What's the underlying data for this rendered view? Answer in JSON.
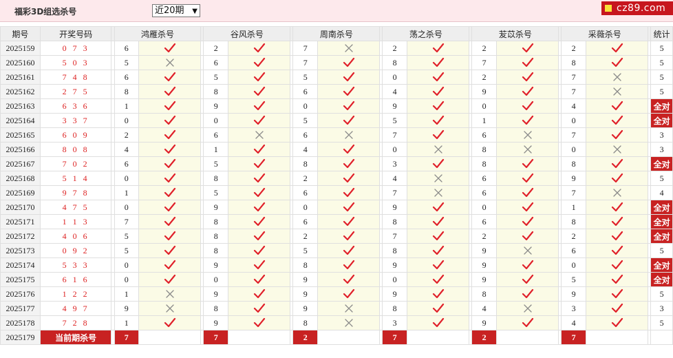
{
  "header": {
    "title": "福彩3D组选杀号",
    "period_select": "近20期",
    "logo": "cz89.com"
  },
  "columns": {
    "issue": "期号",
    "draw": "开奖号码",
    "experts": [
      "鸿雁杀号",
      "谷风杀号",
      "周南杀号",
      "荡之杀号",
      "苃苡杀号",
      "采薇杀号"
    ],
    "count": "统计"
  },
  "full_correct_label": "全对",
  "rows": [
    {
      "issue": "2025159",
      "draw": "0 7 3",
      "kills": [
        {
          "n": "6",
          "ok": true
        },
        {
          "n": "2",
          "ok": true
        },
        {
          "n": "7",
          "ok": false
        },
        {
          "n": "2",
          "ok": true
        },
        {
          "n": "2",
          "ok": true
        },
        {
          "n": "2",
          "ok": true
        }
      ],
      "count": "5"
    },
    {
      "issue": "2025160",
      "draw": "5 0 3",
      "kills": [
        {
          "n": "5",
          "ok": false
        },
        {
          "n": "6",
          "ok": true
        },
        {
          "n": "7",
          "ok": true
        },
        {
          "n": "8",
          "ok": true
        },
        {
          "n": "7",
          "ok": true
        },
        {
          "n": "8",
          "ok": true
        }
      ],
      "count": "5"
    },
    {
      "issue": "2025161",
      "draw": "7 4 8",
      "kills": [
        {
          "n": "6",
          "ok": true
        },
        {
          "n": "5",
          "ok": true
        },
        {
          "n": "5",
          "ok": true
        },
        {
          "n": "0",
          "ok": true
        },
        {
          "n": "2",
          "ok": true
        },
        {
          "n": "7",
          "ok": false
        }
      ],
      "count": "5"
    },
    {
      "issue": "2025162",
      "draw": "2 7 5",
      "kills": [
        {
          "n": "8",
          "ok": true
        },
        {
          "n": "8",
          "ok": true
        },
        {
          "n": "6",
          "ok": true
        },
        {
          "n": "4",
          "ok": true
        },
        {
          "n": "9",
          "ok": true
        },
        {
          "n": "7",
          "ok": false
        }
      ],
      "count": "5"
    },
    {
      "issue": "2025163",
      "draw": "6 3 6",
      "kills": [
        {
          "n": "1",
          "ok": true
        },
        {
          "n": "9",
          "ok": true
        },
        {
          "n": "0",
          "ok": true
        },
        {
          "n": "9",
          "ok": true
        },
        {
          "n": "0",
          "ok": true
        },
        {
          "n": "4",
          "ok": true
        }
      ],
      "count": "全对"
    },
    {
      "issue": "2025164",
      "draw": "3 3 7",
      "kills": [
        {
          "n": "0",
          "ok": true
        },
        {
          "n": "0",
          "ok": true
        },
        {
          "n": "5",
          "ok": true
        },
        {
          "n": "5",
          "ok": true
        },
        {
          "n": "1",
          "ok": true
        },
        {
          "n": "0",
          "ok": true
        }
      ],
      "count": "全对"
    },
    {
      "issue": "2025165",
      "draw": "6 0 9",
      "kills": [
        {
          "n": "2",
          "ok": true
        },
        {
          "n": "6",
          "ok": false
        },
        {
          "n": "6",
          "ok": false
        },
        {
          "n": "7",
          "ok": true
        },
        {
          "n": "6",
          "ok": false
        },
        {
          "n": "7",
          "ok": true
        }
      ],
      "count": "3"
    },
    {
      "issue": "2025166",
      "draw": "8 0 8",
      "kills": [
        {
          "n": "4",
          "ok": true
        },
        {
          "n": "1",
          "ok": true
        },
        {
          "n": "4",
          "ok": true
        },
        {
          "n": "0",
          "ok": false
        },
        {
          "n": "8",
          "ok": false
        },
        {
          "n": "0",
          "ok": false
        }
      ],
      "count": "3"
    },
    {
      "issue": "2025167",
      "draw": "7 0 2",
      "kills": [
        {
          "n": "6",
          "ok": true
        },
        {
          "n": "5",
          "ok": true
        },
        {
          "n": "8",
          "ok": true
        },
        {
          "n": "3",
          "ok": true
        },
        {
          "n": "8",
          "ok": true
        },
        {
          "n": "8",
          "ok": true
        }
      ],
      "count": "全对"
    },
    {
      "issue": "2025168",
      "draw": "5 1 4",
      "kills": [
        {
          "n": "0",
          "ok": true
        },
        {
          "n": "8",
          "ok": true
        },
        {
          "n": "2",
          "ok": true
        },
        {
          "n": "4",
          "ok": false
        },
        {
          "n": "6",
          "ok": true
        },
        {
          "n": "9",
          "ok": true
        }
      ],
      "count": "5"
    },
    {
      "issue": "2025169",
      "draw": "9 7 8",
      "kills": [
        {
          "n": "1",
          "ok": true
        },
        {
          "n": "5",
          "ok": true
        },
        {
          "n": "6",
          "ok": true
        },
        {
          "n": "7",
          "ok": false
        },
        {
          "n": "6",
          "ok": true
        },
        {
          "n": "7",
          "ok": false
        }
      ],
      "count": "4"
    },
    {
      "issue": "2025170",
      "draw": "4 7 5",
      "kills": [
        {
          "n": "0",
          "ok": true
        },
        {
          "n": "9",
          "ok": true
        },
        {
          "n": "0",
          "ok": true
        },
        {
          "n": "9",
          "ok": true
        },
        {
          "n": "0",
          "ok": true
        },
        {
          "n": "1",
          "ok": true
        }
      ],
      "count": "全对"
    },
    {
      "issue": "2025171",
      "draw": "1 1 3",
      "kills": [
        {
          "n": "7",
          "ok": true
        },
        {
          "n": "8",
          "ok": true
        },
        {
          "n": "6",
          "ok": true
        },
        {
          "n": "8",
          "ok": true
        },
        {
          "n": "6",
          "ok": true
        },
        {
          "n": "8",
          "ok": true
        }
      ],
      "count": "全对"
    },
    {
      "issue": "2025172",
      "draw": "4 0 6",
      "kills": [
        {
          "n": "5",
          "ok": true
        },
        {
          "n": "8",
          "ok": true
        },
        {
          "n": "2",
          "ok": true
        },
        {
          "n": "7",
          "ok": true
        },
        {
          "n": "2",
          "ok": true
        },
        {
          "n": "2",
          "ok": true
        }
      ],
      "count": "全对"
    },
    {
      "issue": "2025173",
      "draw": "0 9 2",
      "kills": [
        {
          "n": "5",
          "ok": true
        },
        {
          "n": "8",
          "ok": true
        },
        {
          "n": "5",
          "ok": true
        },
        {
          "n": "8",
          "ok": true
        },
        {
          "n": "9",
          "ok": false
        },
        {
          "n": "6",
          "ok": true
        }
      ],
      "count": "5"
    },
    {
      "issue": "2025174",
      "draw": "5 3 3",
      "kills": [
        {
          "n": "0",
          "ok": true
        },
        {
          "n": "9",
          "ok": true
        },
        {
          "n": "8",
          "ok": true
        },
        {
          "n": "9",
          "ok": true
        },
        {
          "n": "9",
          "ok": true
        },
        {
          "n": "0",
          "ok": true
        }
      ],
      "count": "全对"
    },
    {
      "issue": "2025175",
      "draw": "6 1 6",
      "kills": [
        {
          "n": "0",
          "ok": true
        },
        {
          "n": "0",
          "ok": true
        },
        {
          "n": "9",
          "ok": true
        },
        {
          "n": "0",
          "ok": true
        },
        {
          "n": "9",
          "ok": true
        },
        {
          "n": "5",
          "ok": true
        }
      ],
      "count": "全对"
    },
    {
      "issue": "2025176",
      "draw": "1 2 2",
      "kills": [
        {
          "n": "1",
          "ok": false
        },
        {
          "n": "9",
          "ok": true
        },
        {
          "n": "9",
          "ok": true
        },
        {
          "n": "9",
          "ok": true
        },
        {
          "n": "8",
          "ok": true
        },
        {
          "n": "9",
          "ok": true
        }
      ],
      "count": "5"
    },
    {
      "issue": "2025177",
      "draw": "4 9 7",
      "kills": [
        {
          "n": "9",
          "ok": false
        },
        {
          "n": "8",
          "ok": true
        },
        {
          "n": "9",
          "ok": false
        },
        {
          "n": "8",
          "ok": true
        },
        {
          "n": "4",
          "ok": false
        },
        {
          "n": "3",
          "ok": true
        }
      ],
      "count": "3"
    },
    {
      "issue": "2025178",
      "draw": "7 2 8",
      "kills": [
        {
          "n": "1",
          "ok": true
        },
        {
          "n": "9",
          "ok": true
        },
        {
          "n": "8",
          "ok": false
        },
        {
          "n": "3",
          "ok": true
        },
        {
          "n": "9",
          "ok": true
        },
        {
          "n": "4",
          "ok": true
        }
      ],
      "count": "5"
    }
  ],
  "current": {
    "issue": "2025179",
    "label": "当前期杀号",
    "kills": [
      "7",
      "7",
      "2",
      "7",
      "2",
      "7"
    ]
  },
  "colors": {
    "accent_red": "#c82222",
    "check_red": "#e0202a",
    "cross_gray": "#8a8a8a",
    "cell_yellow": "#fbfbe6"
  }
}
